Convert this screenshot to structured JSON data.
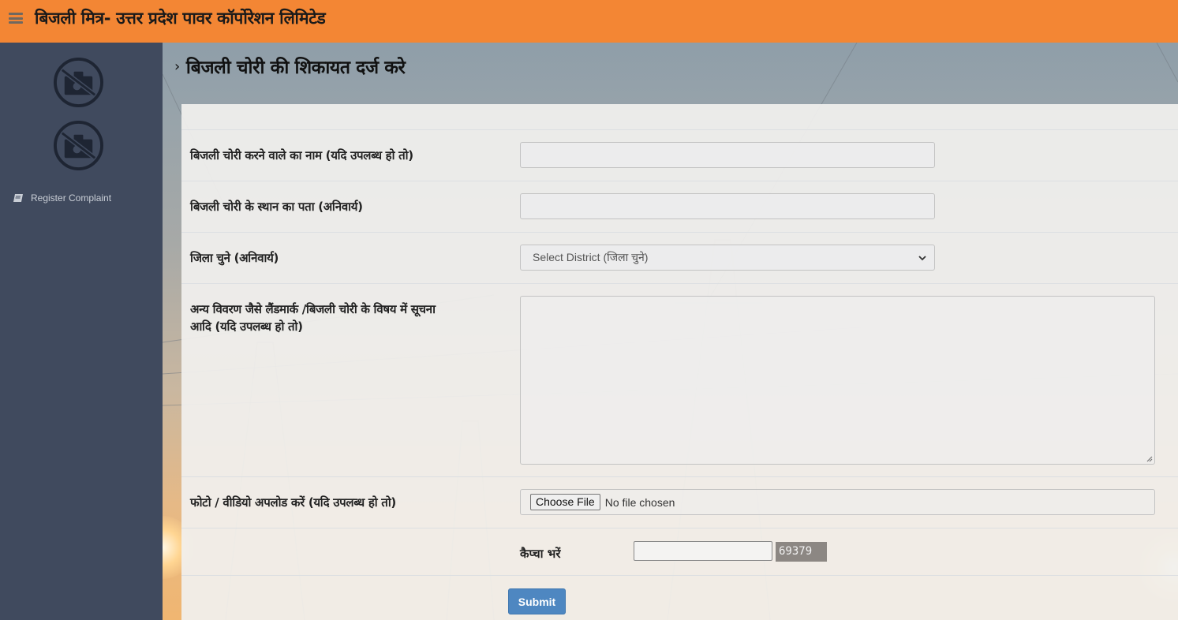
{
  "header": {
    "menu_icon": "hamburger-icon",
    "title": "बिजली मित्र- उत्तर प्रदेश पावर कॉर्पोरेशन लिमिटेड",
    "background_color": "#f38634"
  },
  "sidebar": {
    "images": [
      "no-photo-icon",
      "no-photo-icon"
    ],
    "items": [
      {
        "label": "Register Complaint",
        "icon": "book-icon"
      }
    ],
    "background_color": "#404a5e"
  },
  "main": {
    "heading_prefix": "›",
    "heading": "बिजली चोरी की शिकायत दर्ज करे",
    "form": {
      "fields": [
        {
          "label": "बिजली चोरी करने वाले का नाम (यदि उपलब्ध हो तो)",
          "type": "text",
          "value": ""
        },
        {
          "label": "बिजली चोरी के स्थान का पता (अनिवार्य)",
          "type": "text",
          "value": ""
        },
        {
          "label": "जिला चुने (अनिवार्य)",
          "type": "select",
          "selected": "Select District (जिला चुने)"
        },
        {
          "label_line1": "अन्य विवरण जैसे लैंडमार्क /बिजली चोरी के विषय में सूचना",
          "label_line2": "आदि  (यदि उपलब्ध हो तो)",
          "type": "textarea",
          "value": ""
        },
        {
          "label": "फोटो / वीडियो अपलोड करें (यदि उपलब्ध हो तो)",
          "type": "file",
          "button_label": "Choose File",
          "status": "No file chosen"
        }
      ],
      "captcha": {
        "label": "कैप्चा भरें",
        "value": "",
        "code": "69379"
      },
      "submit_label": "Submit",
      "submit_color": "#4e87c1"
    }
  }
}
